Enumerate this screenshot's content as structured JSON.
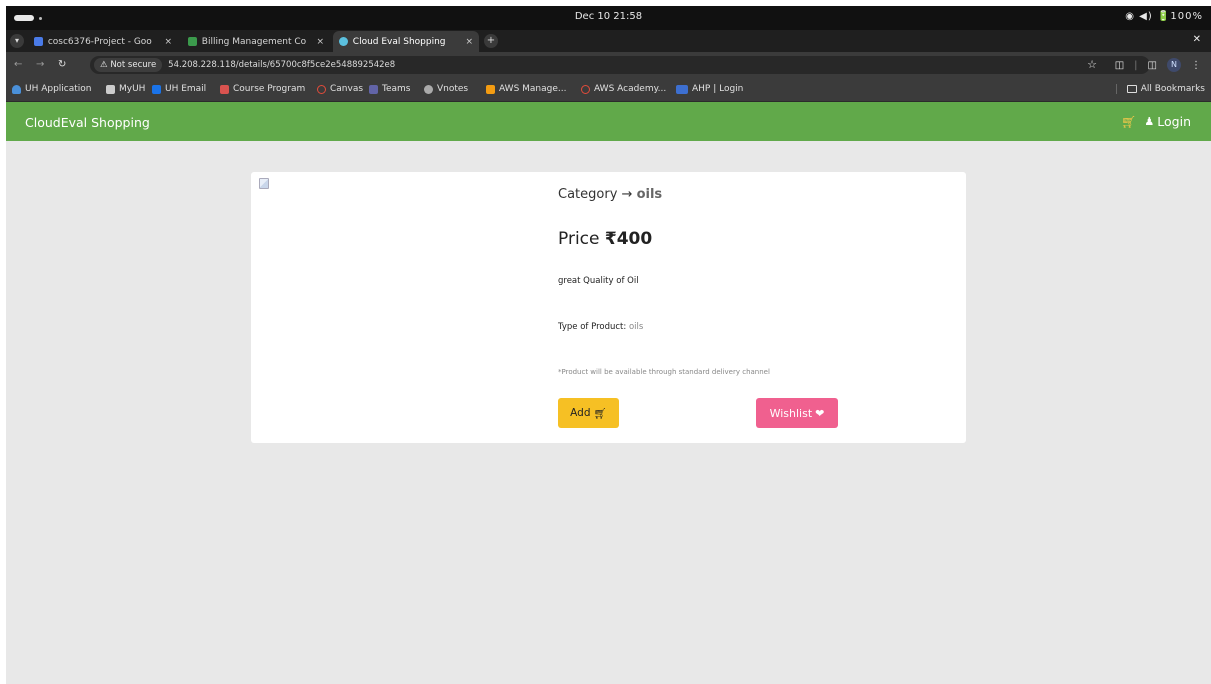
{
  "os": {
    "clock": "Dec 10  21:58",
    "status": "◉ ◀) 🔋100%"
  },
  "tabs": [
    {
      "title": "cosc6376-Project - Goo",
      "favicon_color": "#4a7be8"
    },
    {
      "title": "Billing Management Co",
      "favicon_color": "#3b9a4c"
    },
    {
      "title": "Cloud Eval Shopping",
      "favicon_color": "#5bc0de"
    }
  ],
  "tab_close": "×",
  "new_tab": "+",
  "address": {
    "not_secure": "⚠ Not secure",
    "url": "54.208.228.118/details/65700c8f5ce2e548892542e8"
  },
  "bookmarks": [
    {
      "label": "UH Application",
      "color": "#4a90d9"
    },
    {
      "label": "MyUH",
      "color": "#cccccc"
    },
    {
      "label": "UH Email",
      "color": "#1a73e8"
    },
    {
      "label": "Course Program",
      "color": "#d9534f"
    },
    {
      "label": "Canvas",
      "color": "#e24b3a"
    },
    {
      "label": "Teams",
      "color": "#6264a7"
    },
    {
      "label": "Vnotes",
      "color": "#aaaaaa"
    },
    {
      "label": "AWS Manage...",
      "color": "#f39c12"
    },
    {
      "label": "AWS Academy...",
      "color": "#e24b3a"
    },
    {
      "label": "AHP | Login",
      "color": "#3d6fd0"
    }
  ],
  "all_bookmarks": "All Bookmarks",
  "navbar": {
    "brand": "CloudEval Shopping",
    "login": "Login"
  },
  "product": {
    "category_label": "Category →",
    "category_value": "oils",
    "price_label": "Price",
    "price_value": "₹400",
    "description": "great Quality of Oil",
    "type_label": "Type of Product:",
    "type_value": "oils",
    "delivery_note": "*Product will be available through standard delivery channel",
    "add_label": "Add",
    "wishlist_label": "Wishlist"
  },
  "colors": {
    "navbar": "#61a94a",
    "add_button": "#f6c024",
    "wishlist_button": "#f0608f",
    "page_bg": "#e8e8e8"
  }
}
